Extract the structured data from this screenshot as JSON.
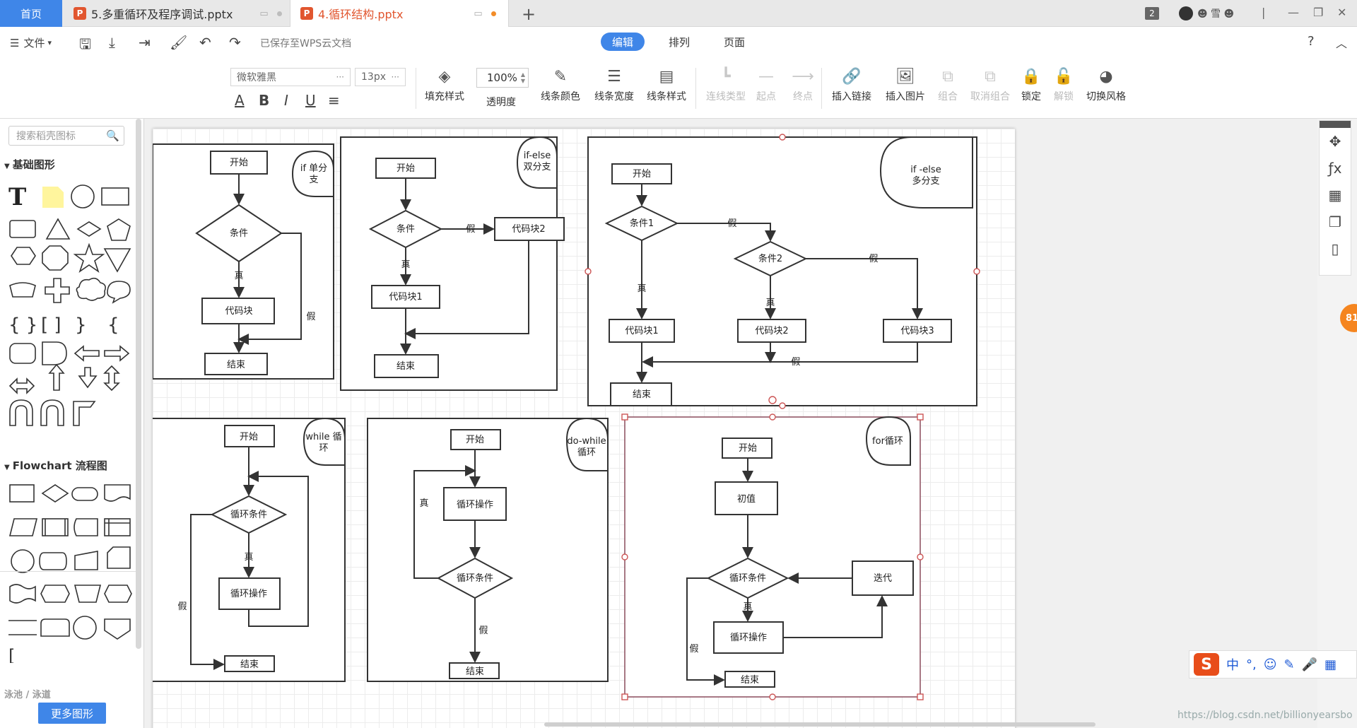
{
  "tabs": {
    "home": "首页",
    "doc1": "5.多重循环及程序调试.pptx",
    "doc2": "4.循环结构.pptx",
    "window_count": "2",
    "user": "☻ 雪 ☻"
  },
  "menu": {
    "file": "文件",
    "saved_status": "已保存至WPS云文档",
    "modes": [
      "编辑",
      "排列",
      "页面"
    ],
    "help": "?"
  },
  "toolbar": {
    "font_family": "微软雅黑",
    "font_size": "13px",
    "opacity_value": "100%",
    "tools": {
      "fill": "填充样式",
      "opacity": "透明度",
      "line_color": "线条颜色",
      "line_width": "线条宽度",
      "line_style": "线条样式",
      "connector": "连线类型",
      "start": "起点",
      "end": "终点",
      "link": "插入链接",
      "image": "插入图片",
      "group": "组合",
      "ungroup": "取消组合",
      "lock": "锁定",
      "unlock": "解锁",
      "theme": "切换风格"
    }
  },
  "left_panel": {
    "search_placeholder": "搜索稻壳图标",
    "section_basic": "基础图形",
    "section_flow": "Flowchart 流程图",
    "section_next": "泳池 / 泳道",
    "more_shapes": "更多图形"
  },
  "diagram": {
    "labels": {
      "start": "开始",
      "end": "结束",
      "cond": "条件",
      "code": "代码块",
      "true": "真",
      "false": "假",
      "code1": "代码块1",
      "code2": "代码块2",
      "code3": "代码块3",
      "cond1": "条件1",
      "cond2": "条件2",
      "loop_cond": "循环条件",
      "loop_op": "循环操作",
      "init": "初值",
      "iter": "迭代"
    },
    "titles": {
      "if_single_1": "if 单分",
      "if_single_2": "支",
      "if_else_1": "if-else",
      "if_else_2": "双分支",
      "if_multi_1": "if -else",
      "if_multi_2": "多分支",
      "while_1": "while 循",
      "while_2": "环",
      "do_while_1": "do-while",
      "do_while_2": "循环",
      "for_1": "for循环"
    }
  },
  "right_side": {
    "badge": "81"
  },
  "ime": {
    "logo": "S",
    "items": [
      "中",
      "°,",
      "☺",
      "✎",
      "🎤",
      "▦"
    ]
  },
  "watermark": "https://blog.csdn.net/billionyearsbo"
}
